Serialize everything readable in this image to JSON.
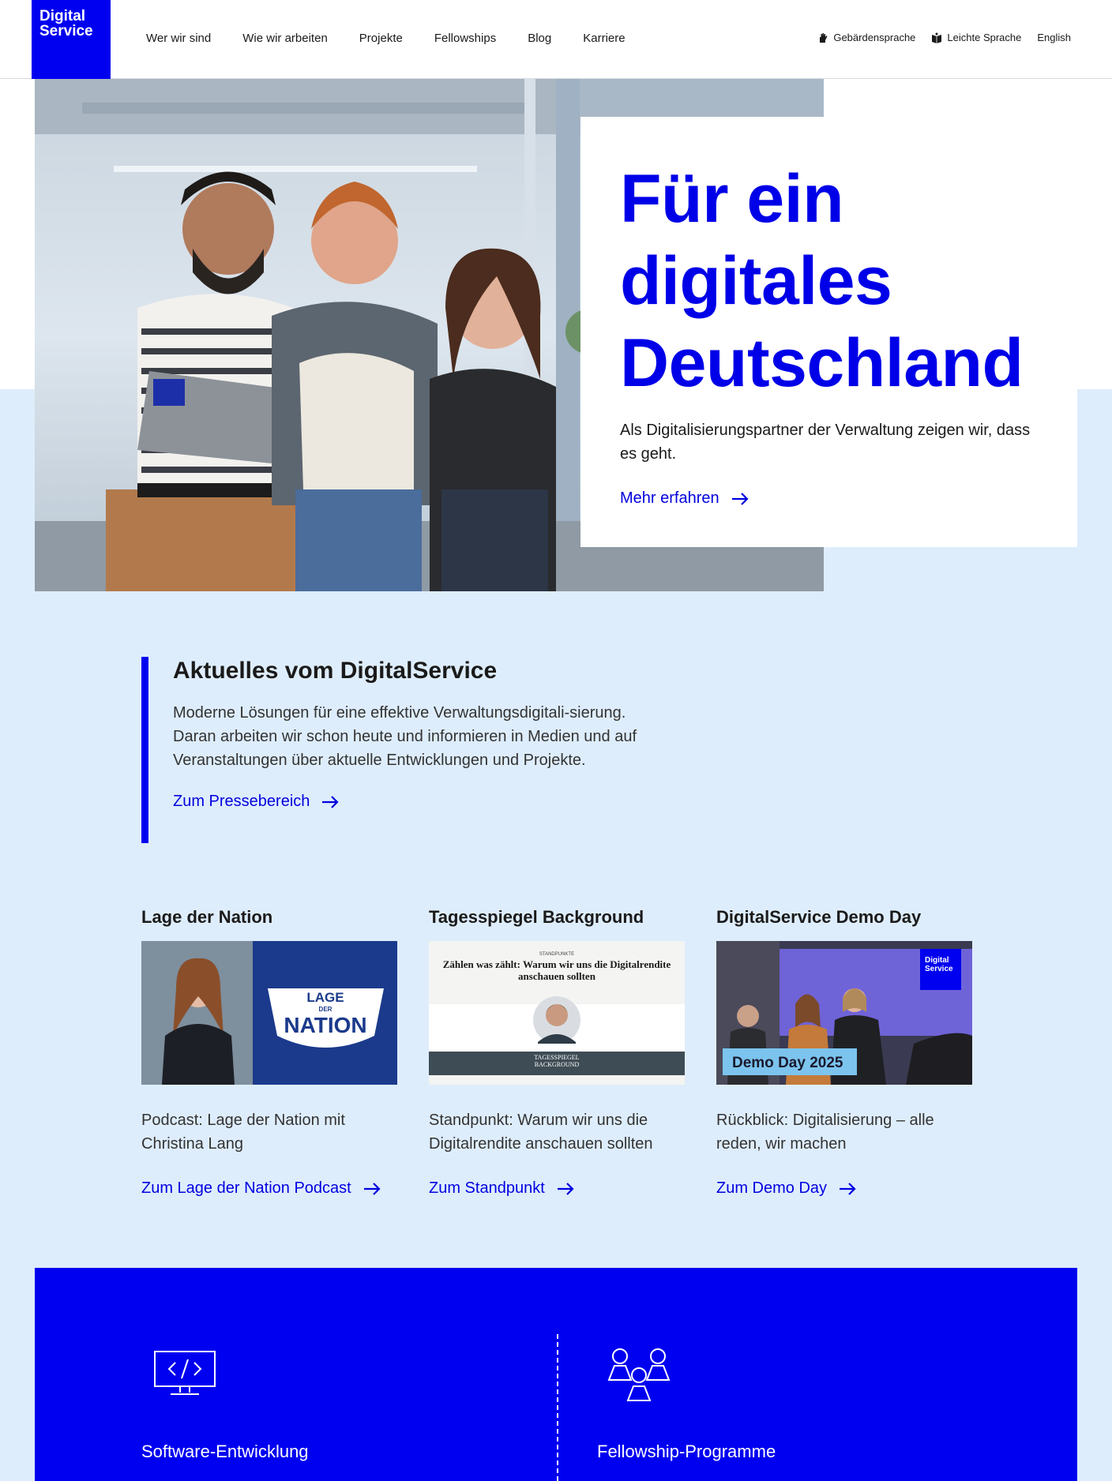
{
  "header": {
    "logo_line1": "Digital",
    "logo_line2": "Service",
    "nav": [
      "Wer wir sind",
      "Wie wir arbeiten",
      "Projekte",
      "Fellowships",
      "Blog",
      "Karriere"
    ],
    "sign_language": "Gebärdensprache",
    "easy_language": "Leichte Sprache",
    "english": "English"
  },
  "hero": {
    "title_line1": "Für ein",
    "title_line2": "digitales",
    "title_line3": "Deutschland",
    "subtitle": "Als Digitalisierungspartner der Verwaltung zeigen wir, dass es geht.",
    "cta": "Mehr erfahren"
  },
  "news": {
    "title": "Aktuelles vom DigitalService",
    "text": "Moderne Lösungen für eine effektive Verwaltungsdigitali-sierung. Daran arbeiten wir schon heute und informieren in Medien und auf Veranstaltungen über aktuelle Entwicklungen und Projekte.",
    "cta": "Zum Pressebereich"
  },
  "cards": [
    {
      "title": "Lage der Nation",
      "image_lettering": [
        "LAGE",
        "DER",
        "NATION"
      ],
      "text": "Podcast: Lage der Nation mit Christina Lang",
      "cta": "Zum Lage der Nation Podcast"
    },
    {
      "title": "Tagesspiegel Background",
      "image_kicker": "STANDPUNKTE",
      "image_headline": "Zählen was zählt: Warum wir uns die Digitalrendite anschauen sollten",
      "image_footer": "TAGESSPIEGEL BACKGROUND",
      "text": "Standpunkt: Warum wir uns die Digitalrendite anschauen sollten",
      "cta": "Zum Standpunkt"
    },
    {
      "title": "DigitalService Demo Day",
      "image_badge": "Demo Day 2025",
      "image_logo": [
        "Digital",
        "Service"
      ],
      "text": "Rückblick: Digitalisierung – alle reden, wir machen",
      "cta": "Zum Demo Day"
    }
  ],
  "services": [
    {
      "label": "Software-Entwicklung",
      "icon": "monitor-code-icon"
    },
    {
      "label": "Fellowship-Programme",
      "icon": "people-group-icon"
    }
  ],
  "colors": {
    "brand_blue": "#0000f0",
    "light_blue_bg": "#deedfc",
    "link_blue": "#0000e0"
  }
}
